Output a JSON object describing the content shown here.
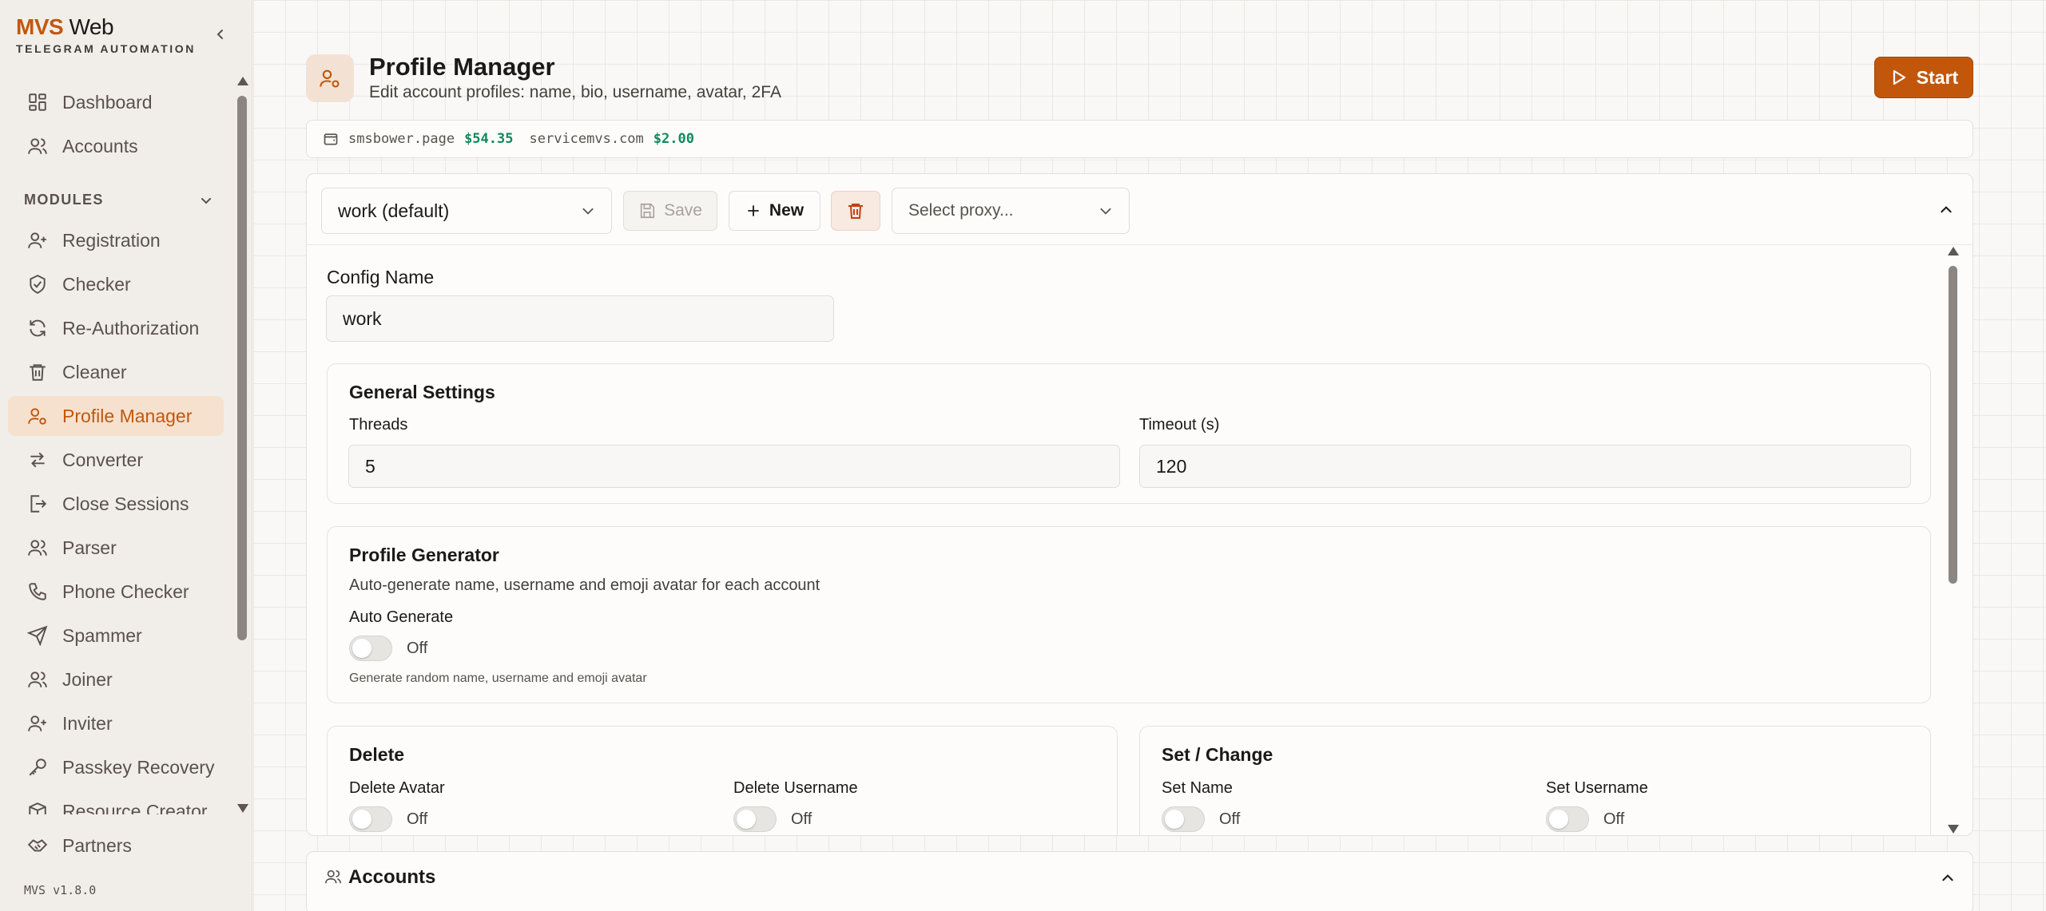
{
  "app": {
    "brand_primary": "MVS",
    "brand_secondary": "Web",
    "subtitle": "TELEGRAM AUTOMATION",
    "version": "MVS v1.8.0"
  },
  "colors": {
    "accent": "#c2570c",
    "active_bg": "#f6e1cf",
    "balance_green": "#0f8a5f"
  },
  "sidebar": {
    "top_items": [
      {
        "label": "Dashboard",
        "icon": "dashboard-icon"
      },
      {
        "label": "Accounts",
        "icon": "users-icon"
      }
    ],
    "modules_label": "MODULES",
    "modules": [
      {
        "label": "Registration",
        "icon": "user-plus-icon"
      },
      {
        "label": "Checker",
        "icon": "shield-check-icon"
      },
      {
        "label": "Re-Authorization",
        "icon": "refresh-icon"
      },
      {
        "label": "Cleaner",
        "icon": "trash-icon"
      },
      {
        "label": "Profile Manager",
        "icon": "user-cog-icon",
        "active": true
      },
      {
        "label": "Converter",
        "icon": "arrows-icon"
      },
      {
        "label": "Close Sessions",
        "icon": "logout-icon"
      },
      {
        "label": "Parser",
        "icon": "users-icon"
      },
      {
        "label": "Phone Checker",
        "icon": "phone-icon"
      },
      {
        "label": "Spammer",
        "icon": "send-icon"
      },
      {
        "label": "Joiner",
        "icon": "users-icon"
      },
      {
        "label": "Inviter",
        "icon": "user-plus-icon"
      },
      {
        "label": "Passkey Recovery",
        "icon": "key-icon"
      },
      {
        "label": "Resource Creator",
        "icon": "box-icon"
      }
    ],
    "partners": "Partners"
  },
  "header": {
    "title": "Profile Manager",
    "subtitle": "Edit account profiles: name, bio, username, avatar, 2FA",
    "start_label": "Start"
  },
  "balances": [
    {
      "host": "smsbower.page",
      "amount": "$54.35"
    },
    {
      "host": "servicemvs.com",
      "amount": "$2.00"
    }
  ],
  "toolbar": {
    "config_select": "work (default)",
    "save_label": "Save",
    "new_label": "New",
    "proxy_placeholder": "Select proxy..."
  },
  "config": {
    "name_label": "Config Name",
    "name_value": "work",
    "general": {
      "title": "General Settings",
      "threads_label": "Threads",
      "threads_value": "5",
      "timeout_label": "Timeout (s)",
      "timeout_value": "120"
    },
    "generator": {
      "title": "Profile Generator",
      "desc": "Auto-generate name, username and emoji avatar for each account",
      "auto_label": "Auto Generate",
      "auto_state": "Off",
      "hint": "Generate random name, username and emoji avatar"
    },
    "delete": {
      "title": "Delete",
      "avatar_label": "Delete Avatar",
      "avatar_state": "Off",
      "username_label": "Delete Username",
      "username_state": "Off"
    },
    "set_change": {
      "title": "Set / Change",
      "name_label": "Set Name",
      "name_state": "Off",
      "username_label": "Set Username",
      "username_state": "Off"
    }
  },
  "accounts_panel": {
    "title": "Accounts"
  }
}
